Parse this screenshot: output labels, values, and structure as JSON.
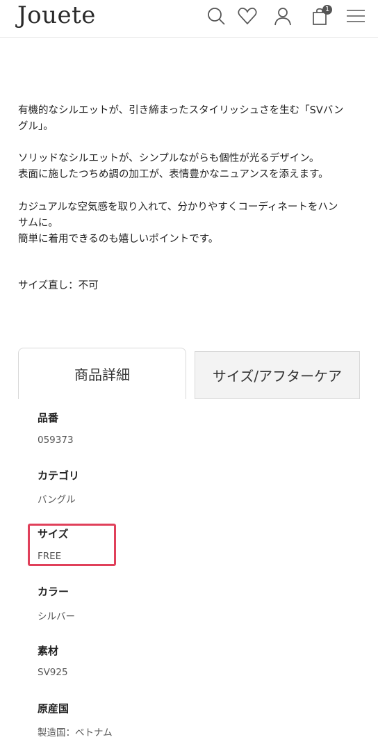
{
  "header": {
    "logo": "Jouete",
    "cart_count": "1",
    "icons": [
      "search-icon",
      "heart-icon",
      "user-icon",
      "cart-icon",
      "menu-icon"
    ]
  },
  "description": {
    "p1_line1": "有機的なシルエットが、引き締まったスタイリッシュさを生む「SVバン",
    "p1_line2": "グル」。",
    "p2_line1": "ソリッドなシルエットが、シンプルながらも個性が光るデザイン。",
    "p2_line2": "表面に施したつちめ調の加工が、表情豊かなニュアンスを添えます。",
    "p3_line1": "カジュアルな空気感を取り入れて、分かりやすくコーディネートをハン",
    "p3_line2": "サムに。",
    "p3_line3": "簡単に着用できるのも嬉しいポイントです。",
    "size_note": "サイズ直し：不可"
  },
  "tabs": {
    "details": "商品詳細",
    "size_care": "サイズ/アフターケア"
  },
  "specs": [
    {
      "label": "品番",
      "value": "059373"
    },
    {
      "label": "カテゴリ",
      "value": "バングル"
    },
    {
      "label": "サイズ",
      "value": "FREE"
    },
    {
      "label": "カラー",
      "value": "シルバー"
    },
    {
      "label": "素材",
      "value": "SV925"
    },
    {
      "label": "原産国",
      "value": "製造国：ベトナム"
    }
  ],
  "colors": {
    "highlight": "#e0405a",
    "inactive_tab_bg": "#f3f3f3"
  }
}
